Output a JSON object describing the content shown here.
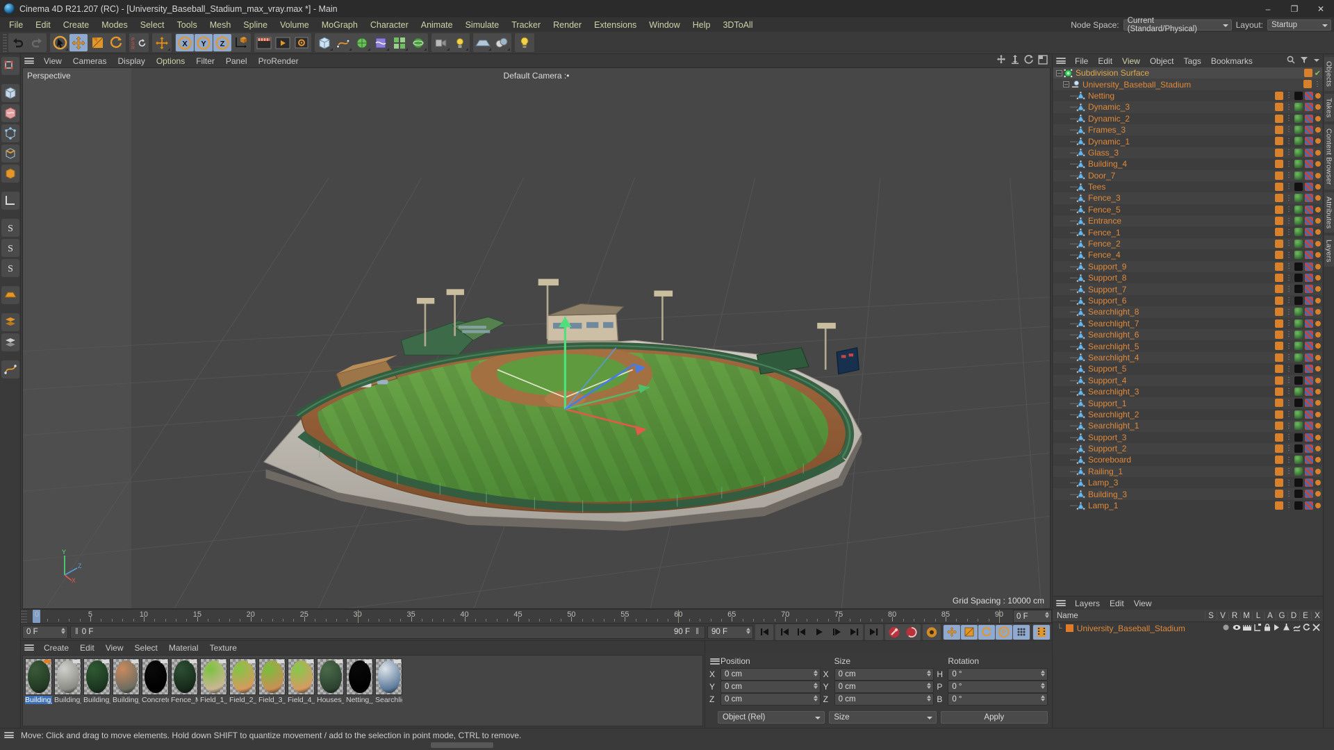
{
  "window": {
    "title": "Cinema 4D R21.207 (RC) - [University_Baseball_Stadium_max_vray.max *] - Main",
    "minimize": "–",
    "maximize": "❐",
    "close": "✕"
  },
  "menubar": {
    "items": [
      "File",
      "Edit",
      "Create",
      "Modes",
      "Select",
      "Tools",
      "Mesh",
      "Spline",
      "Volume",
      "MoGraph",
      "Character",
      "Animate",
      "Simulate",
      "Tracker",
      "Render",
      "Extensions",
      "Window",
      "Help",
      "3DToAll"
    ],
    "node_space_label": "Node Space:",
    "node_space_value": "Current (Standard/Physical)",
    "layout_label": "Layout:",
    "layout_value": "Startup"
  },
  "viewport": {
    "menu": [
      "View",
      "Cameras",
      "Display",
      "Options",
      "Filter",
      "Panel",
      "ProRender"
    ],
    "highlight_item": "Options",
    "label_left": "Perspective",
    "label_center": "Default Camera :•",
    "grid_spacing": "Grid Spacing : 10000 cm",
    "axis_x": "X",
    "axis_y": "Y",
    "axis_z": "Z"
  },
  "timeline": {
    "ticks": [
      "0",
      "5",
      "10",
      "15",
      "20",
      "25",
      "30",
      "35",
      "40",
      "45",
      "50",
      "55",
      "60",
      "65",
      "70",
      "75",
      "80",
      "85",
      "90"
    ],
    "current_frame_right": "0 F",
    "start_field": "0 F",
    "preview_start": "0 F",
    "preview_end": "90 F",
    "end_field": "90 F"
  },
  "materials": {
    "menu": [
      "Create",
      "Edit",
      "View",
      "Select",
      "Material",
      "Texture"
    ],
    "items": [
      {
        "name": "Building_",
        "color1": "#3a5b3a",
        "color2": "#223822",
        "selected": true,
        "tag": "orange"
      },
      {
        "name": "Building_",
        "color1": "#cfcfcb",
        "color2": "#8c8c86",
        "selected": false,
        "tag": "white"
      },
      {
        "name": "Building_",
        "color1": "#2f5a32",
        "color2": "#1b3420",
        "selected": false,
        "tag": "white"
      },
      {
        "name": "Building_",
        "color1": "#c98a5e",
        "color2": "#6d6d62",
        "selected": false,
        "tag": "white"
      },
      {
        "name": "Concrete",
        "color1": "#0a0a0a",
        "color2": "#000000",
        "selected": false,
        "tag": "white"
      },
      {
        "name": "Fence_M",
        "color1": "#2d4f33",
        "color2": "#16291a",
        "selected": false,
        "tag": "white"
      },
      {
        "name": "Field_1_",
        "color1": "#7cc23f",
        "color2": "#cbb694",
        "selected": false,
        "tag": "white"
      },
      {
        "name": "Field_2_",
        "color1": "#82c545",
        "color2": "#d69a5e",
        "selected": false,
        "tag": "white"
      },
      {
        "name": "Field_3_",
        "color1": "#79bd3c",
        "color2": "#c98f55",
        "selected": false,
        "tag": "white"
      },
      {
        "name": "Field_4_",
        "color1": "#86c94b",
        "color2": "#d59a63",
        "selected": false,
        "tag": "white"
      },
      {
        "name": "Houses_",
        "color1": "#4a6a4a",
        "color2": "#2c4230",
        "selected": false,
        "tag": "white"
      },
      {
        "name": "Netting_",
        "color1": "#080808",
        "color2": "#000000",
        "selected": false,
        "tag": "white"
      },
      {
        "name": "Searchlig",
        "color1": "#dde3ea",
        "color2": "#5b7a9a",
        "selected": false,
        "tag": "white"
      }
    ]
  },
  "coordinates": {
    "headers": [
      "Position",
      "Size",
      "Rotation"
    ],
    "rows": [
      {
        "axis_pos": "X",
        "pos": "0 cm",
        "axis_size": "X",
        "size": "0 cm",
        "axis_rot": "H",
        "rot": "0 °"
      },
      {
        "axis_pos": "Y",
        "pos": "0 cm",
        "axis_size": "Y",
        "size": "0 cm",
        "axis_rot": "P",
        "rot": "0 °"
      },
      {
        "axis_pos": "Z",
        "pos": "0 cm",
        "axis_size": "Z",
        "size": "0 cm",
        "axis_rot": "B",
        "rot": "0 °"
      }
    ],
    "mode_value": "Object (Rel)",
    "size_value": "Size",
    "apply_label": "Apply"
  },
  "objects": {
    "menu": [
      "File",
      "Edit",
      "View",
      "Object",
      "Tags",
      "Bookmarks"
    ],
    "tree": [
      {
        "label": "Subdivision Surface",
        "depth": 0,
        "kind": "subdiv",
        "check": true
      },
      {
        "label": "University_Baseball_Stadium",
        "depth": 1,
        "kind": "null"
      },
      {
        "label": "Netting",
        "depth": 2,
        "kind": "poly",
        "tagdark": true
      },
      {
        "label": "Dynamic_3",
        "depth": 2,
        "kind": "poly"
      },
      {
        "label": "Dynamic_2",
        "depth": 2,
        "kind": "poly"
      },
      {
        "label": "Frames_3",
        "depth": 2,
        "kind": "poly"
      },
      {
        "label": "Dynamic_1",
        "depth": 2,
        "kind": "poly"
      },
      {
        "label": "Glass_3",
        "depth": 2,
        "kind": "poly"
      },
      {
        "label": "Building_4",
        "depth": 2,
        "kind": "poly"
      },
      {
        "label": "Door_7",
        "depth": 2,
        "kind": "poly"
      },
      {
        "label": "Tees",
        "depth": 2,
        "kind": "poly",
        "tagdark": true
      },
      {
        "label": "Fence_3",
        "depth": 2,
        "kind": "poly"
      },
      {
        "label": "Fence_5",
        "depth": 2,
        "kind": "poly"
      },
      {
        "label": "Entrance",
        "depth": 2,
        "kind": "poly"
      },
      {
        "label": "Fence_1",
        "depth": 2,
        "kind": "poly"
      },
      {
        "label": "Fence_2",
        "depth": 2,
        "kind": "poly"
      },
      {
        "label": "Fence_4",
        "depth": 2,
        "kind": "poly"
      },
      {
        "label": "Support_9",
        "depth": 2,
        "kind": "poly",
        "tagdark": true
      },
      {
        "label": "Support_8",
        "depth": 2,
        "kind": "poly",
        "tagdark": true
      },
      {
        "label": "Support_7",
        "depth": 2,
        "kind": "poly",
        "tagdark": true
      },
      {
        "label": "Support_6",
        "depth": 2,
        "kind": "poly",
        "tagdark": true
      },
      {
        "label": "Searchlight_8",
        "depth": 2,
        "kind": "poly"
      },
      {
        "label": "Searchlight_7",
        "depth": 2,
        "kind": "poly"
      },
      {
        "label": "Searchlight_6",
        "depth": 2,
        "kind": "poly"
      },
      {
        "label": "Searchlight_5",
        "depth": 2,
        "kind": "poly"
      },
      {
        "label": "Searchlight_4",
        "depth": 2,
        "kind": "poly"
      },
      {
        "label": "Support_5",
        "depth": 2,
        "kind": "poly",
        "tagdark": true
      },
      {
        "label": "Support_4",
        "depth": 2,
        "kind": "poly",
        "tagdark": true
      },
      {
        "label": "Searchlight_3",
        "depth": 2,
        "kind": "poly"
      },
      {
        "label": "Support_1",
        "depth": 2,
        "kind": "poly",
        "tagdark": true
      },
      {
        "label": "Searchlight_2",
        "depth": 2,
        "kind": "poly"
      },
      {
        "label": "Searchlight_1",
        "depth": 2,
        "kind": "poly"
      },
      {
        "label": "Support_3",
        "depth": 2,
        "kind": "poly",
        "tagdark": true
      },
      {
        "label": "Support_2",
        "depth": 2,
        "kind": "poly",
        "tagdark": true
      },
      {
        "label": "Scoreboard",
        "depth": 2,
        "kind": "poly"
      },
      {
        "label": "Railing_1",
        "depth": 2,
        "kind": "poly"
      },
      {
        "label": "Lamp_3",
        "depth": 2,
        "kind": "poly",
        "tagdark": true
      },
      {
        "label": "Building_3",
        "depth": 2,
        "kind": "poly",
        "tagdark": true
      },
      {
        "label": "Lamp_1",
        "depth": 2,
        "kind": "poly",
        "tagdark": true
      }
    ]
  },
  "layers": {
    "menu": [
      "Layers",
      "Edit",
      "View"
    ],
    "columns": [
      "Name",
      "S",
      "V",
      "R",
      "M",
      "L",
      "A",
      "G",
      "D",
      "E",
      "X"
    ],
    "rows": [
      {
        "name": "University_Baseball_Stadium"
      }
    ]
  },
  "side_tabs": [
    "Objects",
    "Takes",
    "Content Browser",
    "Attributes",
    "Layers"
  ],
  "statusbar": {
    "text": "Move: Click and drag to move elements. Hold down SHIFT to quantize movement / add to the selection in point mode, CTRL to remove."
  },
  "colors": {
    "accent_orange": "#e08a3c",
    "select_blue": "#8fa9cf",
    "menu_text": "#cfd3a8",
    "panel_bg": "#3a3a3a"
  }
}
